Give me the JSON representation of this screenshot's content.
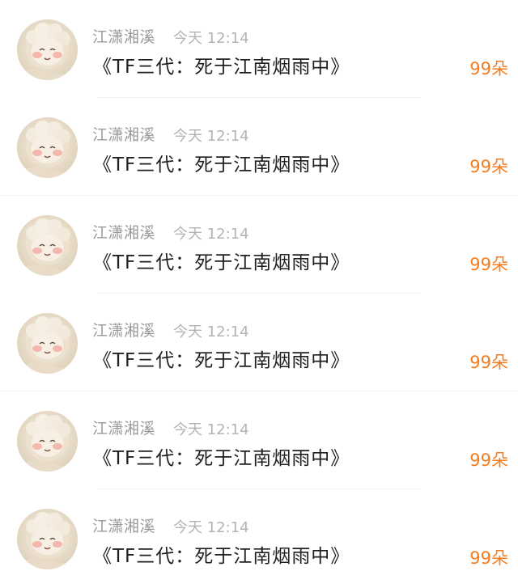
{
  "colors": {
    "accent": "#f57c1f",
    "author": "#9a9a9a",
    "time": "#b3b3b3",
    "text": "#1f1f1f"
  },
  "messages": [
    {
      "avatar_icon": "sheep-avatar-icon",
      "author": "江潇湘溪",
      "time": "今天 12:14",
      "content": "《TF三代：死于江南烟雨中》",
      "flowers": "99朵"
    },
    {
      "avatar_icon": "sheep-avatar-icon",
      "author": "江潇湘溪",
      "time": "今天 12:14",
      "content": "《TF三代：死于江南烟雨中》",
      "flowers": "99朵"
    },
    {
      "avatar_icon": "sheep-avatar-icon",
      "author": "江潇湘溪",
      "time": "今天 12:14",
      "content": "《TF三代：死于江南烟雨中》",
      "flowers": "99朵"
    },
    {
      "avatar_icon": "sheep-avatar-icon",
      "author": "江潇湘溪",
      "time": "今天 12:14",
      "content": "《TF三代：死于江南烟雨中》",
      "flowers": "99朵"
    },
    {
      "avatar_icon": "sheep-avatar-icon",
      "author": "江潇湘溪",
      "time": "今天 12:14",
      "content": "《TF三代：死于江南烟雨中》",
      "flowers": "99朵"
    },
    {
      "avatar_icon": "sheep-avatar-icon",
      "author": "江潇湘溪",
      "time": "今天 12:14",
      "content": "《TF三代：死于江南烟雨中》",
      "flowers": "99朵"
    }
  ]
}
